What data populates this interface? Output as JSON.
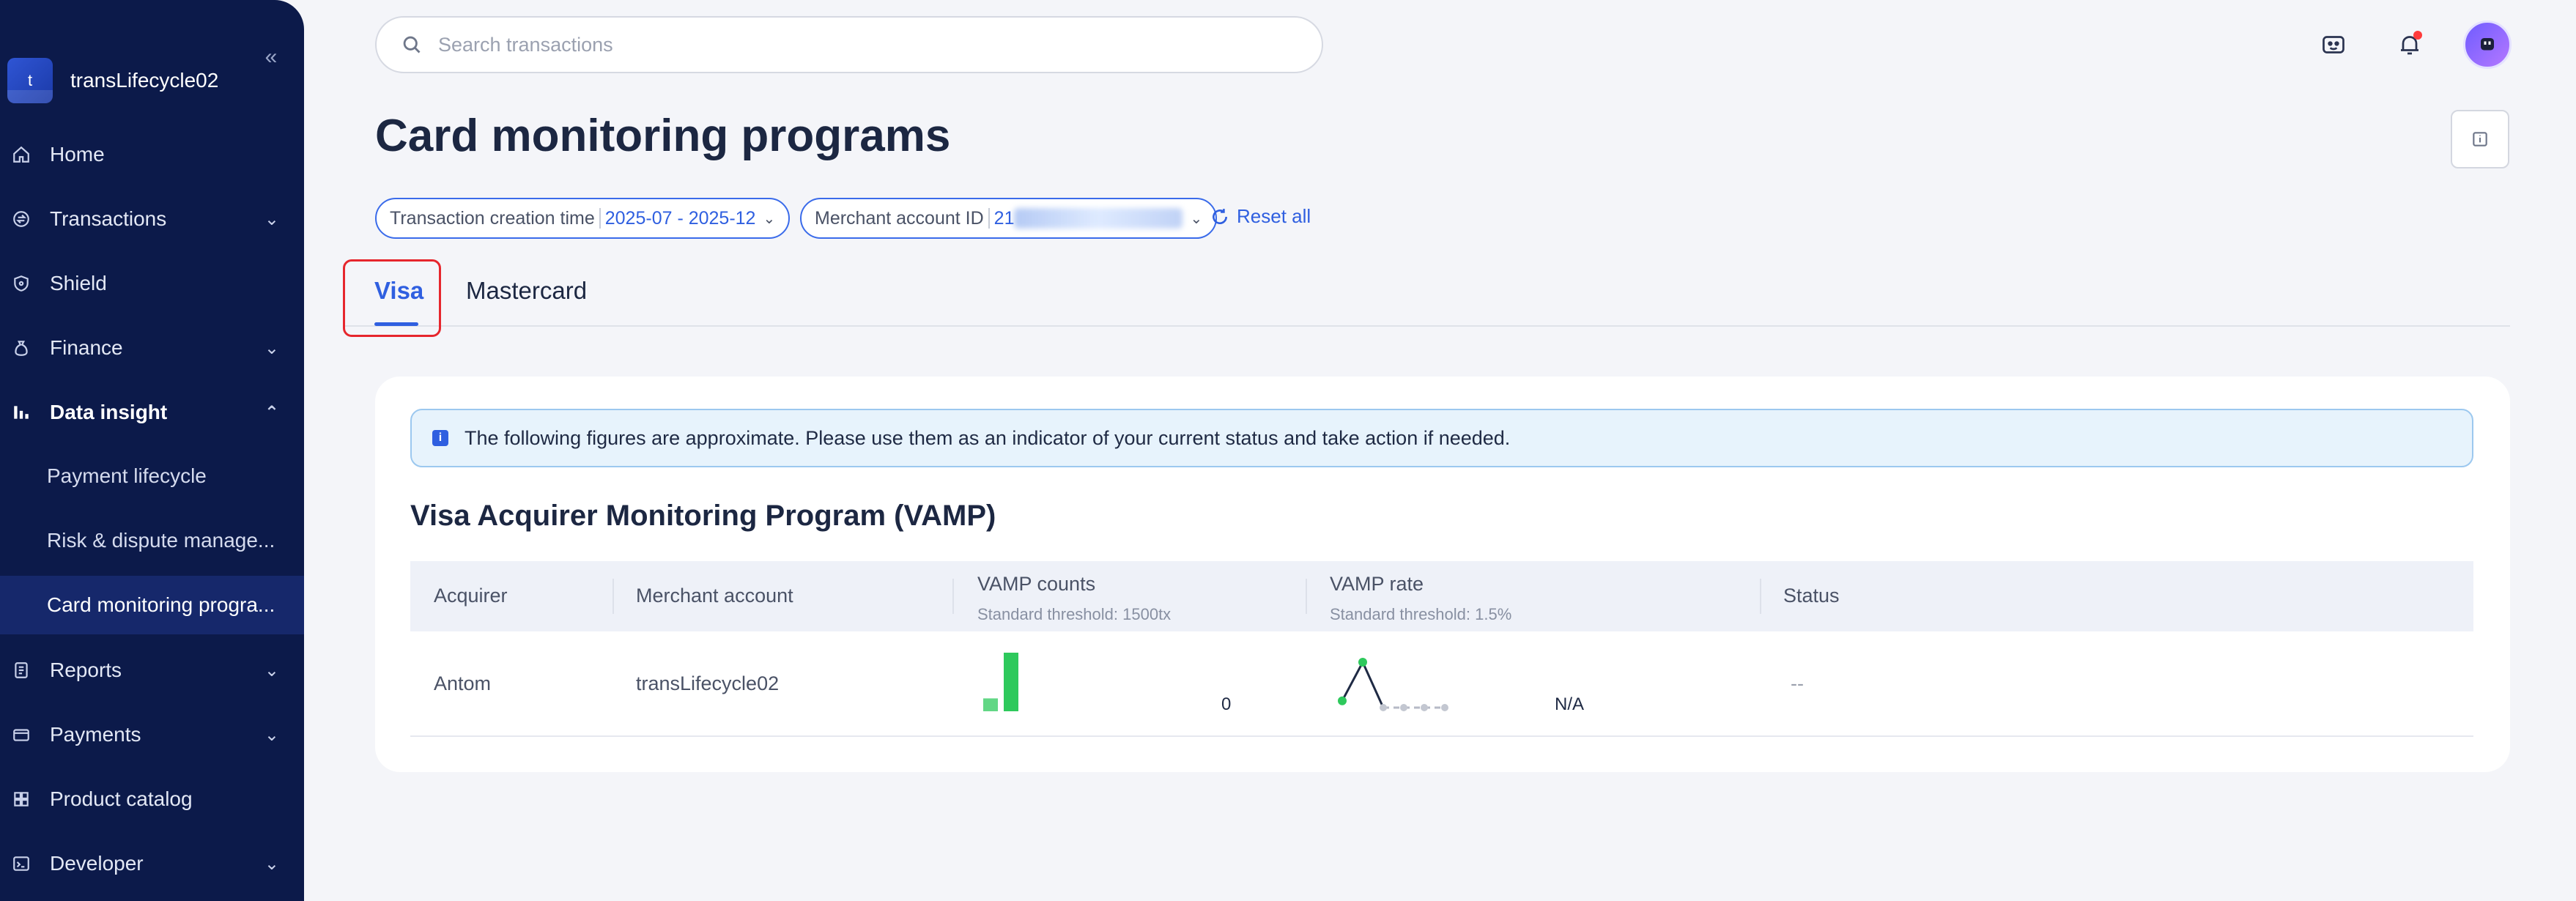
{
  "sidebar": {
    "brand_initial": "t",
    "brand_name": "transLifecycle02",
    "collapse_glyph": "«",
    "items": [
      {
        "label": "Home",
        "icon": "home-icon"
      },
      {
        "label": "Transactions",
        "icon": "transactions-icon"
      },
      {
        "label": "Shield",
        "icon": "shield-icon"
      },
      {
        "label": "Finance",
        "icon": "finance-icon"
      },
      {
        "label": "Data insight",
        "icon": "data-insight-icon"
      },
      {
        "label": "Reports",
        "icon": "reports-icon"
      },
      {
        "label": "Payments",
        "icon": "payments-icon"
      },
      {
        "label": "Product catalog",
        "icon": "product-catalog-icon"
      },
      {
        "label": "Developer",
        "icon": "developer-icon"
      }
    ],
    "sub_items": [
      {
        "label": "Payment lifecycle"
      },
      {
        "label": "Risk & dispute manage..."
      },
      {
        "label": "Card monitoring progra..."
      }
    ],
    "chevron_down": "⌄",
    "chevron_up": "⌃"
  },
  "header": {
    "search_placeholder": "Search transactions"
  },
  "page": {
    "title": "Card monitoring programs"
  },
  "filters": {
    "time_label": "Transaction creation time",
    "time_value": "2025-07 - 2025-12",
    "merchant_label": "Merchant account ID",
    "merchant_value_prefix": "21",
    "chevron": "⌄",
    "reset_label": "Reset all"
  },
  "tabs": {
    "visa": "Visa",
    "mastercard": "Mastercard"
  },
  "notice": {
    "icon_glyph": "i",
    "text": "The following figures are approximate. Please use them as an indicator of your current status and take action if needed."
  },
  "vamp": {
    "title": "Visa Acquirer Monitoring Program (VAMP)",
    "columns": {
      "acquirer": "Acquirer",
      "merchant_account": "Merchant account",
      "vamp_counts": "VAMP counts",
      "vamp_counts_threshold": "Standard threshold: 1500tx",
      "vamp_rate": "VAMP rate",
      "vamp_rate_threshold": "Standard threshold: 1.5%",
      "status": "Status"
    },
    "row": {
      "acquirer": "Antom",
      "merchant_account": "transLifecycle02",
      "vamp_counts_value": "0",
      "vamp_rate_value": "N/A",
      "status": "--"
    },
    "counts_bars": [
      0.22,
      1.0
    ],
    "rate_points": [
      0.15,
      1.0,
      0.0,
      0.0,
      0.0,
      0.0
    ]
  },
  "colors": {
    "sidebar_bg": "#0c1a4a",
    "accent": "#2f5fe0",
    "chart_green": "#2ec95c",
    "highlight_red": "#e6262d"
  }
}
